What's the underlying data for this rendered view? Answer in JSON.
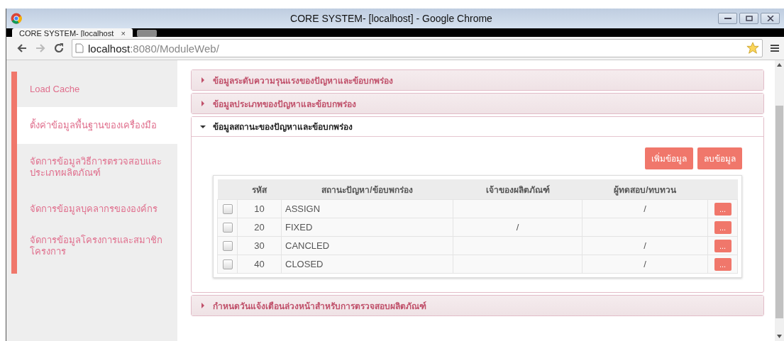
{
  "window": {
    "title": "CORE SYSTEM- [localhost] - Google Chrome"
  },
  "tab": {
    "title": "CORE SYSTEM- [localhost",
    "close": "×"
  },
  "address_bar": {
    "host": "localhost",
    "path": ":8080/ModuleWeb/"
  },
  "sidebar": {
    "items": [
      {
        "label": "Load Cache",
        "selected": false
      },
      {
        "label": "ตั้งค่าข้อมูลพื้นฐานของเครื่องมือ",
        "selected": true
      },
      {
        "label": "จัดการข้อมูลวิธีการตรวจสอบและประเภทผลิตภัณฑ์",
        "selected": false
      },
      {
        "label": "จัดการข้อมูลบุคลากรขององค์กร",
        "selected": false
      },
      {
        "label": "จัดการข้อมูลโครงการและสมาชิกโครงการ",
        "selected": false
      }
    ]
  },
  "sections": [
    {
      "title": "ข้อมูลระดับความรุนแรงของปัญหาและข้อบกพร่อง",
      "expanded": false
    },
    {
      "title": "ข้อมูลประเภทของปัญหาและข้อบกพร่อง",
      "expanded": false
    },
    {
      "title": "ข้อมูลสถานะของปัญหาและข้อบกพร่อง",
      "expanded": true
    },
    {
      "title": "กำหนดวันแจ้งเตือนล่วงหน้าสำหรับการตรวจสอบผลิตภัณฑ์",
      "expanded": false
    }
  ],
  "actions": [
    "เพิ่มข้อมูล",
    "ลบข้อมูล"
  ],
  "table": {
    "columns": [
      "รหัส",
      "สถานะปัญหา/ข้อบพกร่อง",
      "เจ้าของผลิตภัณฑ์",
      "ผู้ทดสอบ/ทบทวน"
    ],
    "rows": [
      {
        "checked": false,
        "code": "10",
        "status": "ASSIGN",
        "owner": "",
        "tester": "/",
        "button": "..."
      },
      {
        "checked": false,
        "code": "20",
        "status": "FIXED",
        "owner": "/",
        "tester": "",
        "button": "..."
      },
      {
        "checked": false,
        "code": "30",
        "status": "CANCLED",
        "owner": "",
        "tester": "/",
        "button": "..."
      },
      {
        "checked": false,
        "code": "40",
        "status": "CLOSED",
        "owner": "",
        "tester": "/",
        "button": "..."
      }
    ]
  }
}
